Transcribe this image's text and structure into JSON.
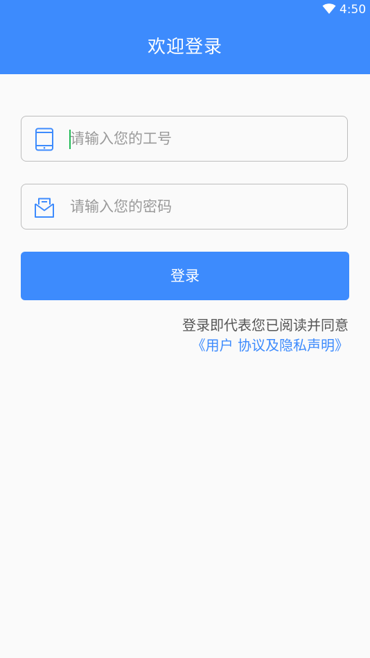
{
  "status_bar": {
    "time": "4:50",
    "wifi_icon": "wifi-icon"
  },
  "header": {
    "title": "欢迎登录"
  },
  "form": {
    "employee_id": {
      "icon": "tablet-icon",
      "placeholder": "请输入您的工号",
      "value": ""
    },
    "password": {
      "icon": "envelope-icon",
      "placeholder": "请输入您的密码",
      "value": ""
    },
    "login_label": "登录"
  },
  "agreement": {
    "text": "登录即代表您已阅读并同意",
    "link": "《用户 协议及隐私声明》"
  },
  "colors": {
    "primary": "#3d8bfd",
    "background": "#fafafa",
    "border": "#bdbdbd",
    "placeholder": "#9a9a9a",
    "caret": "#1db954"
  }
}
